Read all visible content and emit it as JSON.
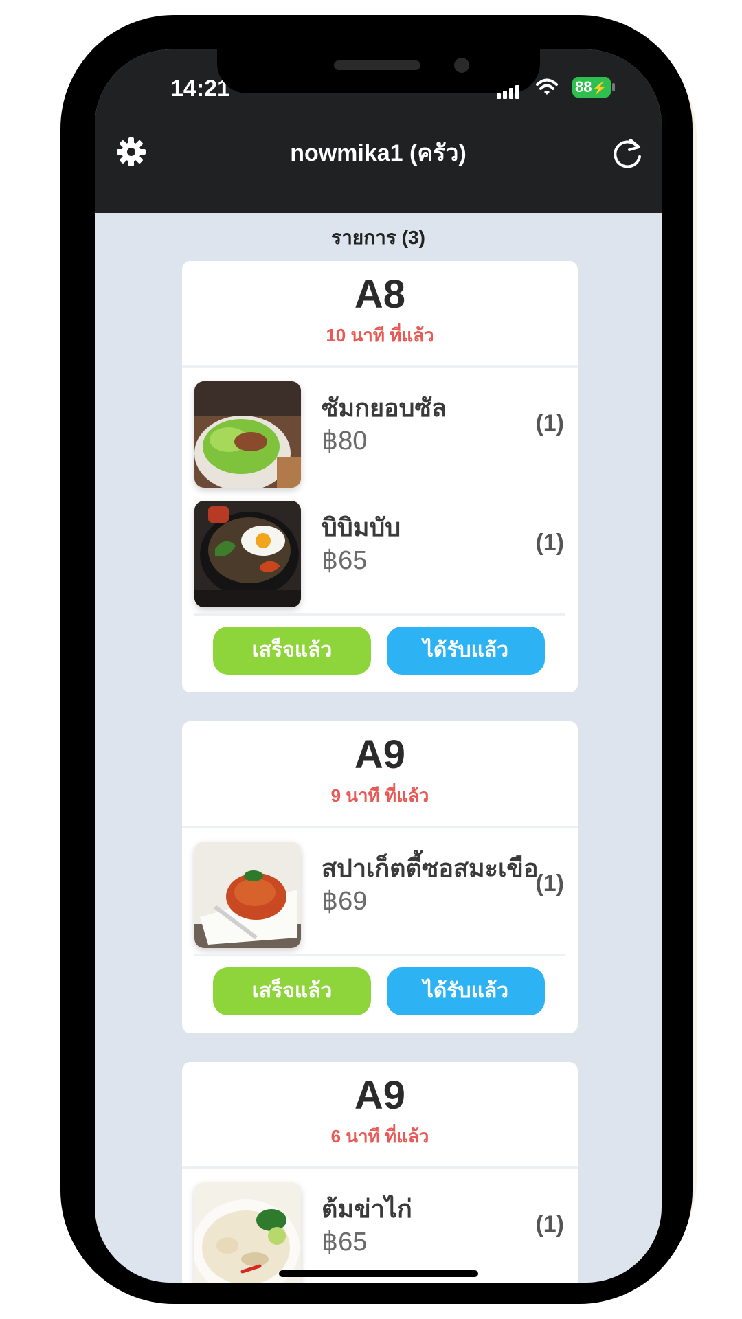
{
  "status_bar": {
    "time": "14:21",
    "battery": "88"
  },
  "header": {
    "title": "nowmika1 (ครัว)",
    "settings_icon": "gear-icon",
    "refresh_icon": "refresh-icon"
  },
  "list_title": "รายการ (3)",
  "orders": [
    {
      "table": "A8",
      "elapsed": "10 นาที ที่แล้ว",
      "items": [
        {
          "name": "ซัมกยอบซัล",
          "price": "฿80",
          "qty": "(1)"
        },
        {
          "name": "บิบิมบับ",
          "price": "฿65",
          "qty": "(1)"
        }
      ],
      "done_label": "เสร็จแล้ว",
      "received_label": "ได้รับแล้ว"
    },
    {
      "table": "A9",
      "elapsed": "9 นาที ที่แล้ว",
      "items": [
        {
          "name": "สปาเก็ตตี้ซอสมะเขือ",
          "price": "฿69",
          "qty": "(1)"
        }
      ],
      "done_label": "เสร็จแล้ว",
      "received_label": "ได้รับแล้ว"
    },
    {
      "table": "A9",
      "elapsed": "6 นาที ที่แล้ว",
      "items": [
        {
          "name": "ต้มข่าไก่",
          "price": "฿65",
          "qty": "(1)"
        }
      ]
    }
  ],
  "colors": {
    "header_bg": "#202122",
    "screen_bg": "#dde4ed",
    "elapsed_text": "#e95a56",
    "done_button": "#8ed43b",
    "received_button": "#2db3f4"
  }
}
